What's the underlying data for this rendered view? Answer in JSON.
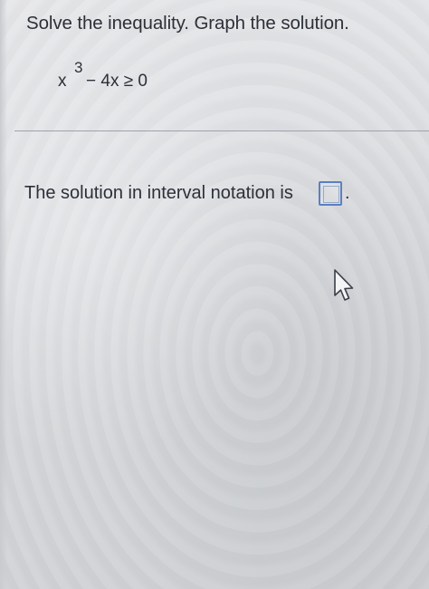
{
  "question": {
    "instruction": "Solve the inequality. Graph the solution.",
    "equation": {
      "base": "x",
      "exponent": "3",
      "rest": "− 4x ≥ 0"
    }
  },
  "answer": {
    "prompt": "The solution in interval notation is",
    "input_value": "",
    "trailing": "."
  },
  "cursor": {
    "icon": "arrow-pointer-icon"
  },
  "colors": {
    "text": "#2c3038",
    "input_border": "#5a7fc4",
    "divider": "#9ea3ab"
  }
}
